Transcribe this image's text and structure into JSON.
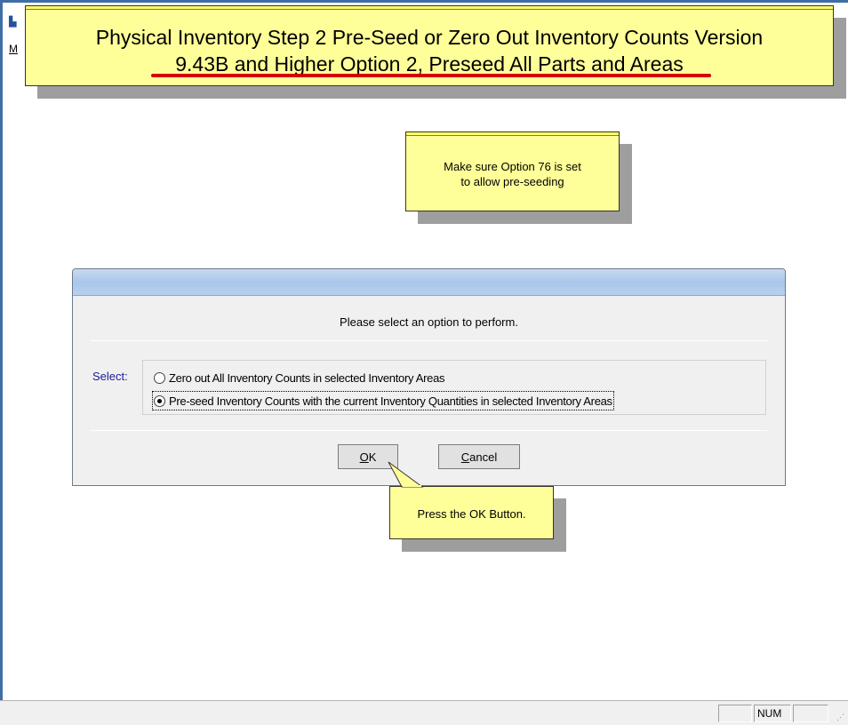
{
  "app": {
    "icon": "app-icon",
    "menu_letter": "M"
  },
  "title_callout": {
    "line1": "Physical Inventory Step 2 Pre-Seed or Zero Out Inventory Counts Version",
    "line2": "9.43B and Higher Option 2, Preseed All Parts and Areas"
  },
  "note_callout": {
    "line1": "Make sure Option 76 is set",
    "line2": "to allow pre-seeding"
  },
  "dialog": {
    "prompt": "Please select an option to perform.",
    "select_label": "Select:",
    "options": [
      {
        "label": "Zero out All Inventory Counts in selected Inventory Areas",
        "checked": false
      },
      {
        "label": "Pre-seed Inventory Counts with the current Inventory Quantities in selected Inventory Areas",
        "checked": true
      }
    ],
    "ok_label_u": "O",
    "ok_label_rest": "K",
    "cancel_label_u": "C",
    "cancel_label_rest": "ancel"
  },
  "press_callout": {
    "text": "Press the OK Button."
  },
  "statusbar": {
    "cells": [
      "",
      "NUM",
      ""
    ]
  },
  "colors": {
    "callout_fill": "#ffff99",
    "underline_red": "#d40000",
    "select_label": "#1a1a9a"
  }
}
